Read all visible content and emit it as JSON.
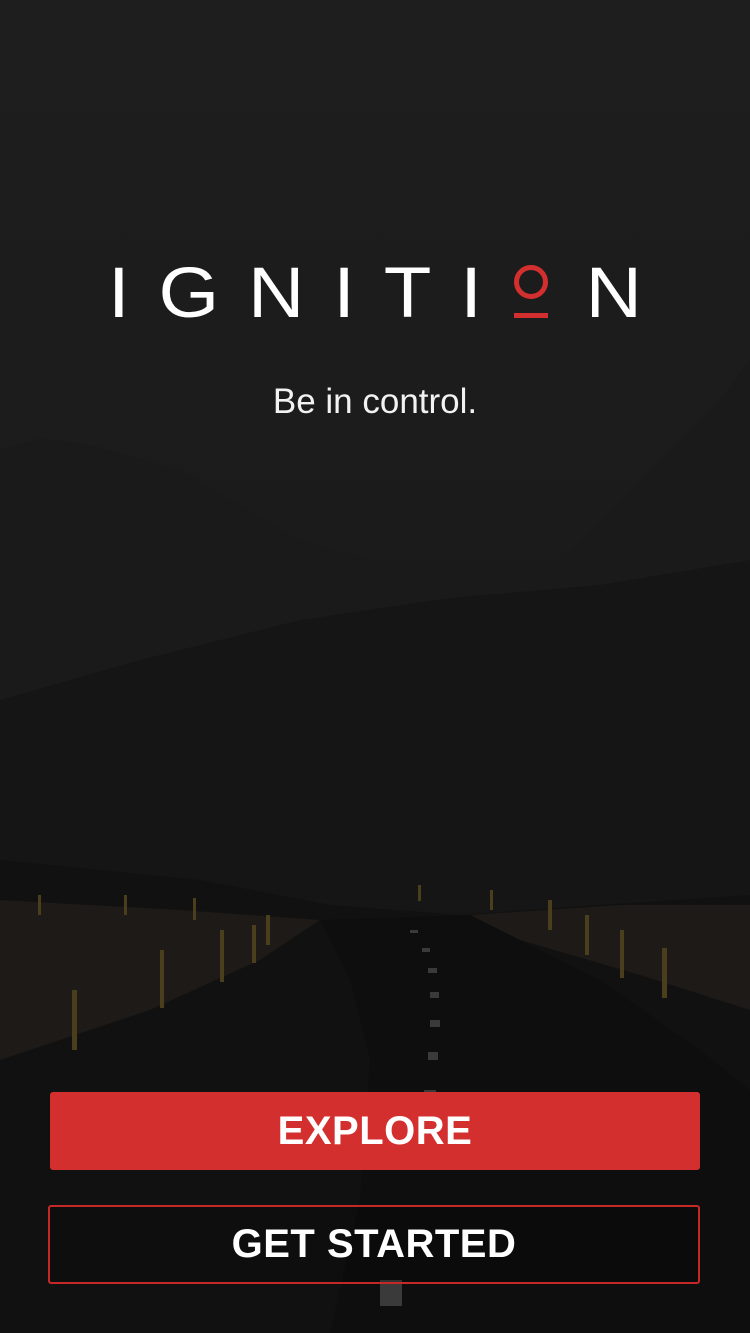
{
  "app": {
    "logo_letters": [
      "I",
      "G",
      "N",
      "I",
      "T",
      "I",
      "N"
    ],
    "logo_o_icon": "power-o-icon",
    "accent_color": "#d32f2f",
    "tagline": "Be in control."
  },
  "actions": {
    "explore_label": "EXPLORE",
    "get_started_label": "GET STARTED"
  },
  "background": {
    "image": "dark-mountain-road-photo"
  }
}
